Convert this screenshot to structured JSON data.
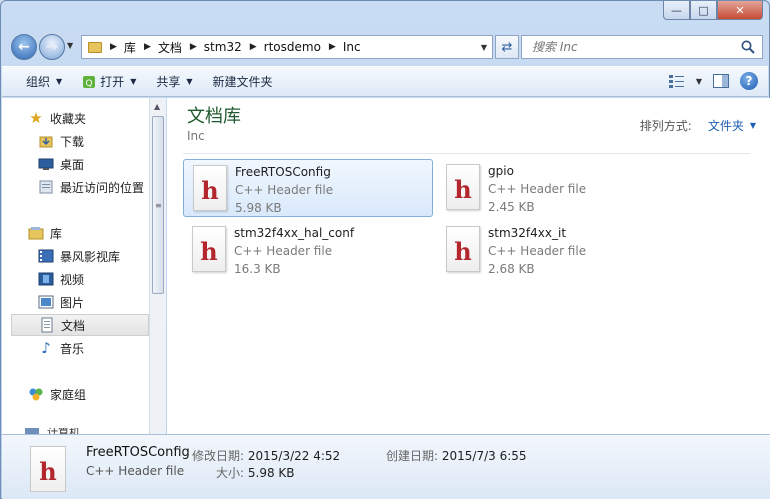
{
  "window": {
    "caption_icons": [
      "minimize-icon",
      "maximize-icon",
      "close-icon"
    ]
  },
  "address_bar": {
    "crumbs": [
      "库",
      "文档",
      "stm32",
      "rtosdemo",
      "Inc"
    ]
  },
  "search": {
    "placeholder": "搜索 Inc"
  },
  "toolbar": {
    "organize": "组织",
    "open": "打开",
    "share": "共享",
    "new_folder": "新建文件夹"
  },
  "nav_pane": {
    "favorites": {
      "label": "收藏夹",
      "items": [
        "下载",
        "桌面",
        "最近访问的位置"
      ]
    },
    "libraries": {
      "label": "库",
      "items": [
        "暴风影视库",
        "视频",
        "图片",
        "文档",
        "音乐"
      ],
      "selected": "文档"
    },
    "homegroup": "家庭组",
    "computer_partial": "计算机"
  },
  "content": {
    "title": "文档库",
    "subtitle": "Inc",
    "arrange_label": "排列方式:",
    "arrange_value": "文件夹",
    "files": [
      {
        "name": "FreeRTOSConfig",
        "type": "C++ Header file",
        "size": "5.98 KB",
        "selected": true
      },
      {
        "name": "gpio",
        "type": "C++ Header file",
        "size": "2.45 KB",
        "selected": false
      },
      {
        "name": "stm32f4xx_hal_conf",
        "type": "C++ Header file",
        "size": "16.3 KB",
        "selected": false
      },
      {
        "name": "stm32f4xx_it",
        "type": "C++ Header file",
        "size": "2.68 KB",
        "selected": false
      }
    ]
  },
  "details": {
    "name": "FreeRTOSConfig",
    "type": "C++ Header file",
    "modified_label": "修改日期:",
    "modified_value": "2015/3/22 4:52",
    "created_label": "创建日期:",
    "created_value": "2015/7/3 6:55",
    "size_label": "大小:",
    "size_value": "5.98 KB"
  },
  "colors": {
    "library_title": "#1e5a2e",
    "link_blue": "#1f5fb5",
    "file_icon_red": "#b3262e"
  }
}
